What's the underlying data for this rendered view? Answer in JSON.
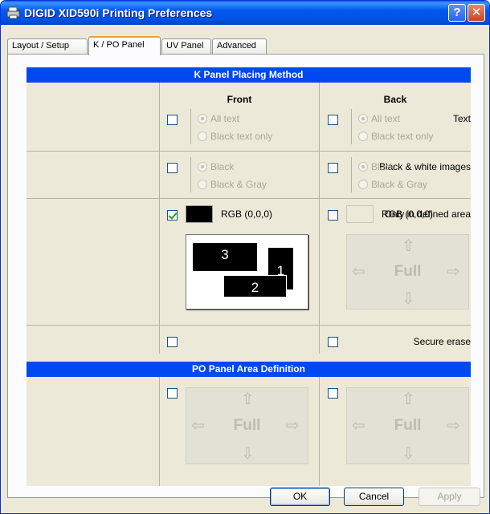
{
  "window": {
    "title": "DIGID XID590i Printing Preferences"
  },
  "tabs": [
    {
      "label": "Layout / Setup"
    },
    {
      "label": "K / PO Panel"
    },
    {
      "label": "UV Panel"
    },
    {
      "label": "Advanced"
    }
  ],
  "k_panel": {
    "header": "K Panel Placing Method",
    "front_title": "Front",
    "back_title": "Back",
    "rows": {
      "text": {
        "label": "Text",
        "front": {
          "checked": false,
          "options": [
            "All text",
            "Black text only"
          ]
        },
        "back": {
          "checked": false,
          "options": [
            "All text",
            "Black text only"
          ]
        }
      },
      "bw_images": {
        "label": "Black & white images",
        "front": {
          "checked": false,
          "options": [
            "Black",
            "Black & Gray"
          ]
        },
        "back": {
          "checked": false,
          "options": [
            "Black",
            "Black & Gray"
          ]
        }
      },
      "defined_area": {
        "label": "Only in defined area",
        "front": {
          "checked": true,
          "color": "#000000",
          "rgb": "RGB (0,0,0)",
          "areas": [
            "3",
            "1",
            "2"
          ]
        },
        "back": {
          "checked": false,
          "color": "#ece9d8",
          "rgb": "RGB (0,0,0)",
          "full": "Full"
        }
      },
      "secure_erase": {
        "label": "Secure erase",
        "front": {
          "checked": false
        },
        "back": {
          "checked": false
        }
      }
    }
  },
  "po_panel": {
    "header": "PO Panel Area Definition",
    "front": {
      "checked": false,
      "full": "Full"
    },
    "back": {
      "checked": false,
      "full": "Full"
    }
  },
  "buttons": {
    "ok": "OK",
    "cancel": "Cancel",
    "apply": "Apply"
  }
}
